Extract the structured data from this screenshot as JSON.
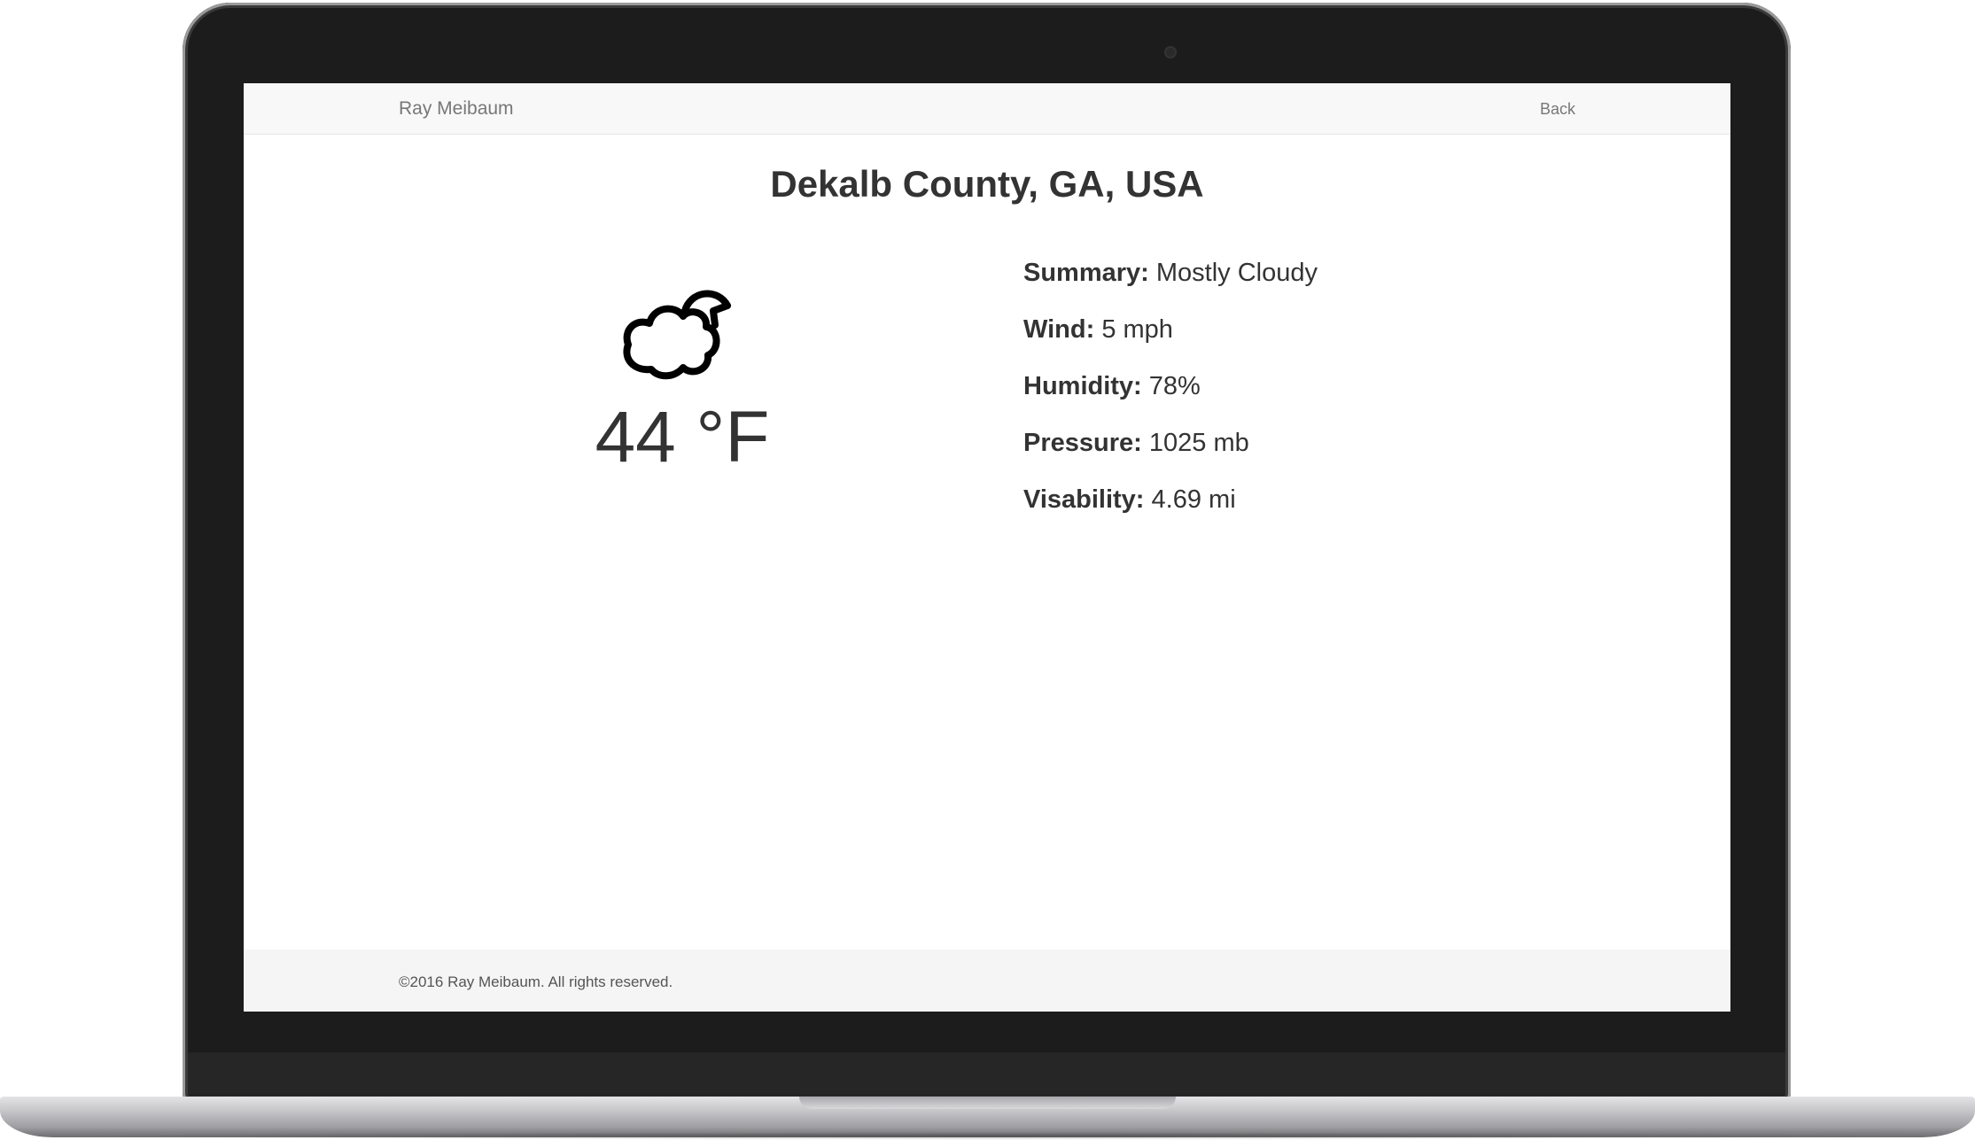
{
  "navbar": {
    "brand": "Ray Meibaum",
    "back_label": "Back"
  },
  "location": {
    "title": "Dekalb County, GA, USA"
  },
  "current": {
    "icon": "partly-cloudy-icon",
    "temperature": "44 °F"
  },
  "details": [
    {
      "label": "Summary:",
      "value": "Mostly Cloudy"
    },
    {
      "label": "Wind:",
      "value": "5 mph"
    },
    {
      "label": "Humidity:",
      "value": "78%"
    },
    {
      "label": "Pressure:",
      "value": "1025 mb"
    },
    {
      "label": "Visability:",
      "value": "4.69 mi"
    }
  ],
  "footer": {
    "copyright": "©2016 Ray Meibaum. All rights reserved."
  }
}
